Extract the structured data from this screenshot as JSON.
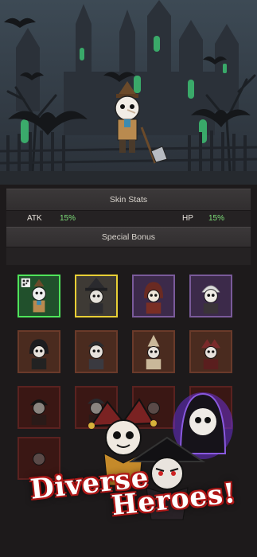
{
  "stats_panel": {
    "header": "Skin Stats",
    "atk_label": "ATK",
    "atk_value": "15%",
    "hp_label": "HP",
    "hp_value": "15%",
    "bonus_header": "Special Bonus"
  },
  "promo": {
    "line1": "Diverse",
    "line2": "Heroes!"
  },
  "skins": [
    {
      "row": 1,
      "col": 1,
      "frame": "green",
      "selected": true,
      "badge": "qr-icon"
    },
    {
      "row": 1,
      "col": 2,
      "frame": "gold"
    },
    {
      "row": 1,
      "col": 3,
      "frame": "purple"
    },
    {
      "row": 1,
      "col": 4,
      "frame": "purple"
    },
    {
      "row": 2,
      "col": 1,
      "frame": "brown"
    },
    {
      "row": 2,
      "col": 2,
      "frame": "brown"
    },
    {
      "row": 2,
      "col": 3,
      "frame": "brown"
    },
    {
      "row": 2,
      "col": 4,
      "frame": "brown"
    },
    {
      "row": 3,
      "col": 1,
      "frame": "dim"
    },
    {
      "row": 3,
      "col": 2,
      "frame": "dim"
    },
    {
      "row": 3,
      "col": 3,
      "frame": "dim"
    },
    {
      "row": 3,
      "col": 4,
      "frame": "dim"
    },
    {
      "row": 4,
      "col": 1,
      "frame": "dim"
    }
  ],
  "colors": {
    "stat_value": "#7fe07a",
    "selected_frame": "#4fe55a",
    "gold_frame": "#e8cf35",
    "promo_outline": "#b01818"
  }
}
